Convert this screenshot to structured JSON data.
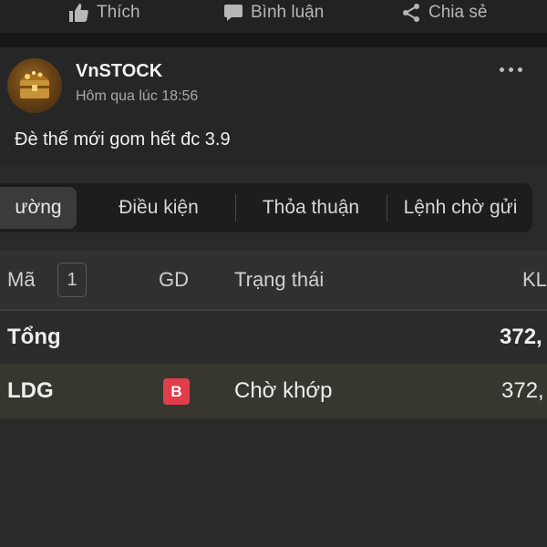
{
  "action_bar": {
    "like_label": "Thích",
    "comment_label": "Bình luận",
    "share_label": "Chia sẻ"
  },
  "post": {
    "author": "VnSTOCK",
    "timestamp": "Hôm qua lúc 18:56",
    "caption": "Đè thế mới gom hết đc 3.9"
  },
  "order_screen": {
    "tabs": [
      {
        "label": "ường",
        "active": true
      },
      {
        "label": "Điều kiện",
        "active": false
      },
      {
        "label": "Thỏa thuận",
        "active": false
      },
      {
        "label": "Lệnh chờ gửi",
        "active": false
      }
    ],
    "columns": {
      "symbol": "Mã",
      "count": "1",
      "side": "GD",
      "status": "Trạng thái",
      "qty": "KL"
    },
    "total_row": {
      "label": "Tổng",
      "qty": "372,"
    },
    "rows": [
      {
        "symbol": "LDG",
        "side": "B",
        "status": "Chờ khớp",
        "qty": "372,"
      }
    ]
  },
  "colors": {
    "buy_badge": "#e23d4b",
    "highlight_row": "#38372f",
    "background": "#262626"
  }
}
